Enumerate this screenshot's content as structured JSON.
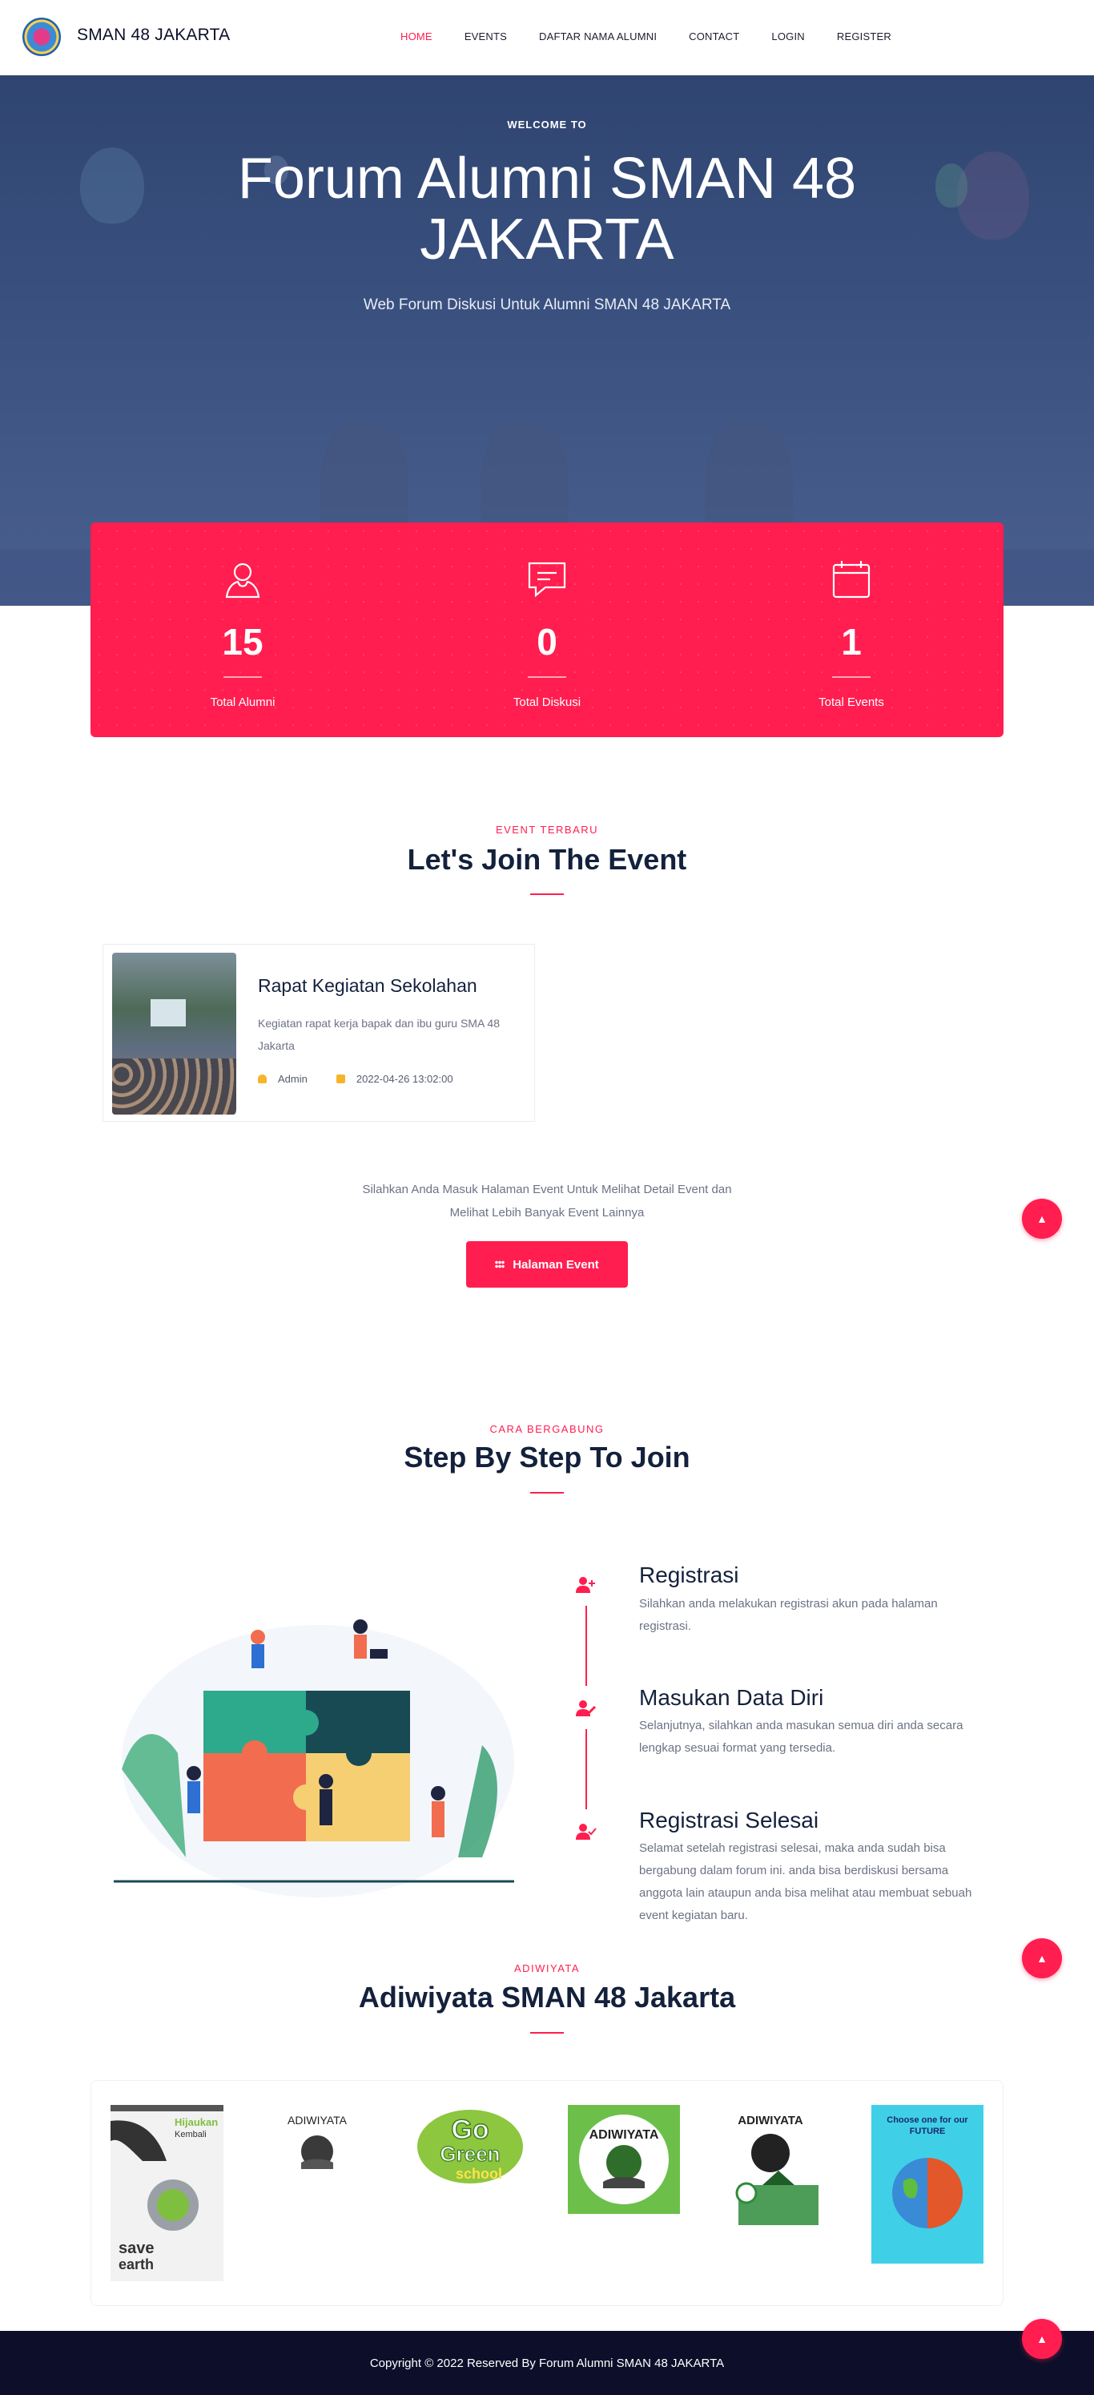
{
  "nav": {
    "brand": "SMAN 48 JAKARTA",
    "links": [
      "HOME",
      "EVENTS",
      "DAFTAR NAMA ALUMNI",
      "CONTACT",
      "LOGIN",
      "REGISTER"
    ],
    "active": "HOME"
  },
  "hero": {
    "welcome": "WELCOME TO",
    "title": "Forum Alumni SMAN 48 JAKARTA",
    "subtitle": "Web Forum Diskusi Untuk Alumni SMAN 48 JAKARTA"
  },
  "stats": [
    {
      "icon": "user-icon",
      "value": "15",
      "label": "Total Alumni"
    },
    {
      "icon": "chat-icon",
      "value": "0",
      "label": "Total Diskusi"
    },
    {
      "icon": "calendar-icon",
      "value": "1",
      "label": "Total Events"
    }
  ],
  "events_section": {
    "kicker": "EVENT TERBARU",
    "title": "Let's Join The Event",
    "event": {
      "title": "Rapat Kegiatan Sekolahan",
      "description": "Kegiatan rapat kerja bapak dan ibu guru SMA 48 Jakarta",
      "author": "Admin",
      "date": "2022-04-26 13:02:00"
    },
    "note_line1": "Silahkan Anda Masuk Halaman Event Untuk Melihat Detail Event dan",
    "note_line2": "Melihat Lebih Banyak Event Lainnya",
    "button": "Halaman Event"
  },
  "steps_section": {
    "kicker": "CARA BERGABUNG",
    "title": "Step By Step To Join",
    "steps": [
      {
        "icon": "user-plus-icon",
        "title": "Registrasi",
        "description": "Silahkan anda melakukan registrasi akun pada halaman registrasi."
      },
      {
        "icon": "user-edit-icon",
        "title": "Masukan Data Diri",
        "description": "Selanjutnya, silahkan anda masukan semua diri anda secara lengkap sesuai format yang tersedia."
      },
      {
        "icon": "user-check-icon",
        "title": "Registrasi Selesai",
        "description": "Selamat setelah registrasi selesai, maka anda sudah bisa bergabung dalam forum ini. anda bisa berdiskusi bersama anggota lain ataupun anda bisa melihat atau membuat sebuah event kegiatan baru."
      }
    ]
  },
  "adiwiyata_section": {
    "kicker": "ADIWIYATA",
    "title": "Adiwiyata SMAN 48 Jakarta",
    "images": [
      {
        "name": "save-earth-poster",
        "text": "Hijaukan Kembali Untuk Bumi Kita"
      },
      {
        "name": "adiwiyata-logo-small",
        "text": "ADIWIYATA"
      },
      {
        "name": "go-green-school-logo",
        "text": "Go Green School"
      },
      {
        "name": "adiwiyata-logo-green",
        "text": "ADIWIYATA"
      },
      {
        "name": "adiwiyata-school-logo",
        "text": "ADIWIYATA"
      },
      {
        "name": "future-poster",
        "text": "Choose one for our FUTURE"
      }
    ]
  },
  "footer": {
    "copyright": "Copyright © 2022 Reserved By Forum Alumni SMAN 48 JAKARTA"
  },
  "colors": {
    "accent": "#ff1e4f",
    "navy": "#14213d",
    "footer": "#0d0f2a",
    "hero": "#3a5180"
  }
}
